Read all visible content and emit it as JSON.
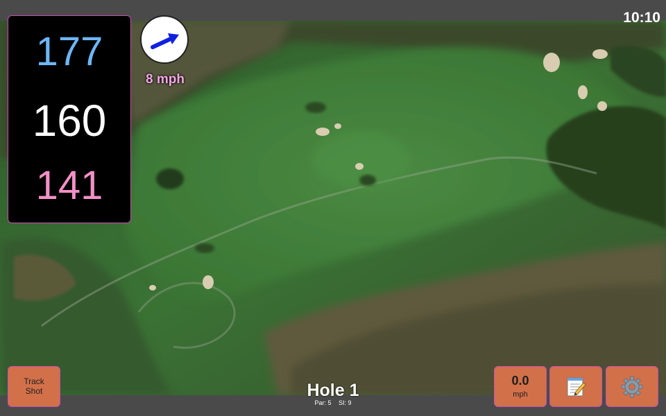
{
  "status": {
    "time": "10:10"
  },
  "distances": {
    "back": "177",
    "center": "160",
    "front": "141",
    "colors": {
      "back": "#6eb6f5",
      "center": "#ffffff",
      "front": "#f291c6"
    }
  },
  "wind": {
    "speed_label": "8 mph",
    "direction_icon": "arrow-icon",
    "arrow_color": "#1020e0",
    "label_color": "#f5a8e6"
  },
  "buttons": {
    "track_shot_line1": "Track",
    "track_shot_line2": "Shot",
    "speed_value": "0.0",
    "speed_unit": "mph",
    "notes_icon": "notepad-icon",
    "settings_icon": "gear-icon",
    "color": "#d2704a"
  },
  "hole": {
    "title": "Hole 1",
    "par": "Par: 5",
    "si": "SI: 9"
  },
  "map": {
    "colors": {
      "fairway": "#3d7a38",
      "rough": "#2e5a28",
      "trees": "#2a3c22",
      "scrub": "#5e5a3c",
      "bunker": "#d8cdb0"
    }
  }
}
